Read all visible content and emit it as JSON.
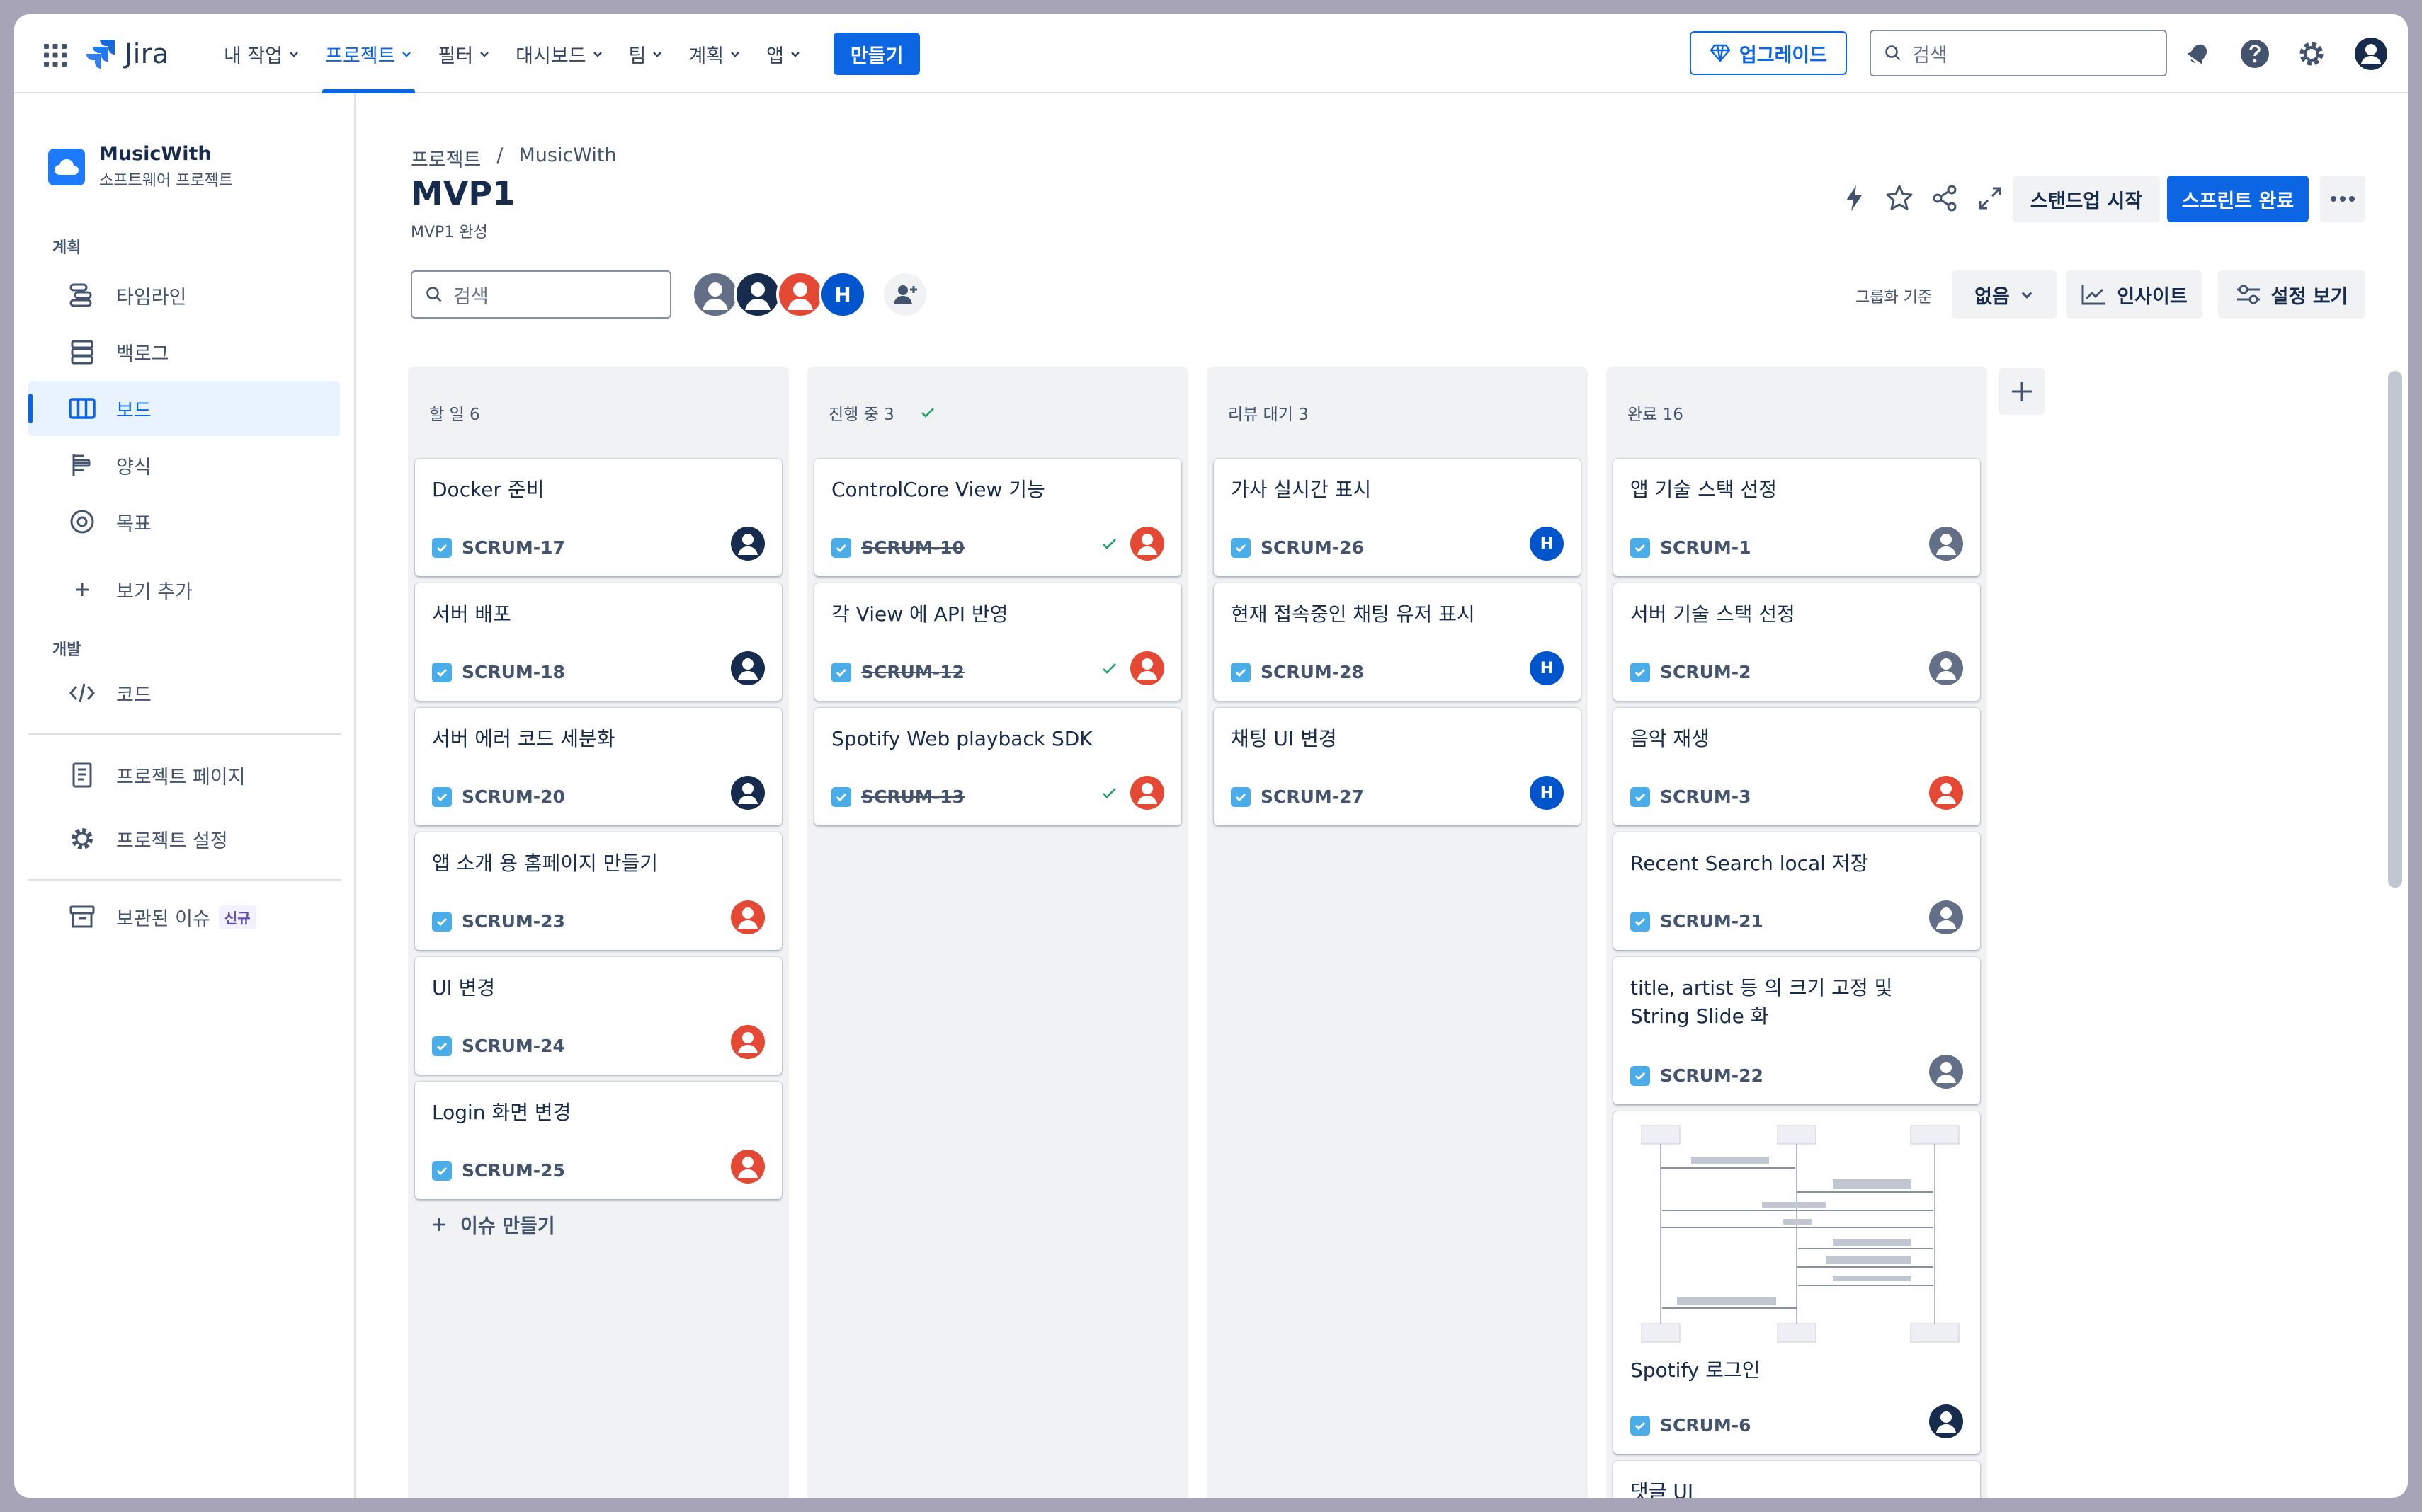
{
  "topnav": {
    "logo_text": "Jira",
    "menu": [
      {
        "label": "내 작업",
        "active": false
      },
      {
        "label": "프로젝트",
        "active": true
      },
      {
        "label": "필터",
        "active": false
      },
      {
        "label": "대시보드",
        "active": false
      },
      {
        "label": "팀",
        "active": false
      },
      {
        "label": "계획",
        "active": false
      },
      {
        "label": "앱",
        "active": false
      }
    ],
    "create_label": "만들기",
    "upgrade_label": "업그레이드",
    "search_placeholder": "검색"
  },
  "sidebar": {
    "project_name": "MusicWith",
    "project_type": "소프트웨어 프로젝트",
    "section_plan": "계획",
    "plan_items": [
      {
        "label": "타임라인",
        "icon": "timeline-icon"
      },
      {
        "label": "백로그",
        "icon": "backlog-icon"
      },
      {
        "label": "보드",
        "icon": "board-icon",
        "active": true
      },
      {
        "label": "양식",
        "icon": "forms-icon"
      },
      {
        "label": "목표",
        "icon": "goals-icon"
      }
    ],
    "add_view_label": "보기 추가",
    "section_dev": "개발",
    "code_label": "코드",
    "project_pages_label": "프로젝트 페이지",
    "project_settings_label": "프로젝트 설정",
    "archived_label": "보관된 이슈",
    "archived_badge": "신규"
  },
  "header": {
    "breadcrumb_root": "프로젝트",
    "breadcrumb_sep": "/",
    "breadcrumb_project": "MusicWith",
    "title": "MVP1",
    "subtitle": "MVP1 완성",
    "standup_label": "스탠드업 시작",
    "complete_sprint_label": "스프린트 완료"
  },
  "toolbar": {
    "search_placeholder": "검색",
    "group_by_label": "그룹화 기준",
    "group_by_value": "없음",
    "insights_label": "인사이트",
    "view_settings_label": "설정 보기",
    "avatar_initial": "H"
  },
  "columns": [
    {
      "title": "할 일 6",
      "cards": [
        {
          "title": "Docker 준비",
          "key": "SCRUM-17",
          "avatar": "dark",
          "done": false
        },
        {
          "title": "서버 배포",
          "key": "SCRUM-18",
          "avatar": "dark",
          "done": false
        },
        {
          "title": "서버 에러 코드 세분화",
          "key": "SCRUM-20",
          "avatar": "dark",
          "done": false
        },
        {
          "title": "앱 소개 용 홈페이지 만들기",
          "key": "SCRUM-23",
          "avatar": "orange",
          "done": false
        },
        {
          "title": "UI 변경",
          "key": "SCRUM-24",
          "avatar": "orange",
          "done": false
        },
        {
          "title": "Login 화면 변경",
          "key": "SCRUM-25",
          "avatar": "orange",
          "done": false
        }
      ],
      "create_label": "이슈 만들기"
    },
    {
      "title": "진행 중 3",
      "cards": [
        {
          "title": "ControlCore View 기능",
          "key": "SCRUM-10",
          "avatar": "orange",
          "done": true
        },
        {
          "title": "각 View 에 API 반영",
          "key": "SCRUM-12",
          "avatar": "orange",
          "done": true
        },
        {
          "title": "Spotify Web playback SDK",
          "key": "SCRUM-13",
          "avatar": "orange",
          "done": true
        }
      ]
    },
    {
      "title": "리뷰 대기 3",
      "cards": [
        {
          "title": "가사 실시간 표시",
          "key": "SCRUM-26",
          "avatar": "blue-h",
          "done": false
        },
        {
          "title": "현재 접속중인 채팅 유저 표시",
          "key": "SCRUM-28",
          "avatar": "blue-h",
          "done": false
        },
        {
          "title": "채팅 UI 변경",
          "key": "SCRUM-27",
          "avatar": "blue-h",
          "done": false
        }
      ]
    },
    {
      "title": "완료 16",
      "cards": [
        {
          "title": "앱 기술 스택 선정",
          "key": "SCRUM-1",
          "avatar": "gray",
          "done": false
        },
        {
          "title": "서버 기술 스택 선정",
          "key": "SCRUM-2",
          "avatar": "gray",
          "done": false
        },
        {
          "title": "음악 재생",
          "key": "SCRUM-3",
          "avatar": "orange",
          "done": false
        },
        {
          "title": "Recent Search local 저장",
          "key": "SCRUM-21",
          "avatar": "gray",
          "done": false
        },
        {
          "title": "title, artist 등 의 크기 고정 및 String Slide 화",
          "key": "SCRUM-22",
          "avatar": "gray",
          "done": false
        },
        {
          "title": "Spotify 로그인",
          "key": "SCRUM-6",
          "avatar": "dark",
          "done": false,
          "has_image": true
        },
        {
          "title": "댓글 UI",
          "key": "",
          "avatar": "",
          "done": false
        }
      ]
    }
  ],
  "colors": {
    "brand_blue": "#0c66e4",
    "avatar_dark": "#172b4d",
    "avatar_orange": "#e34935",
    "avatar_gray": "#626f86",
    "avatar_blue": "#0055cc",
    "done_green": "#22a06b"
  }
}
